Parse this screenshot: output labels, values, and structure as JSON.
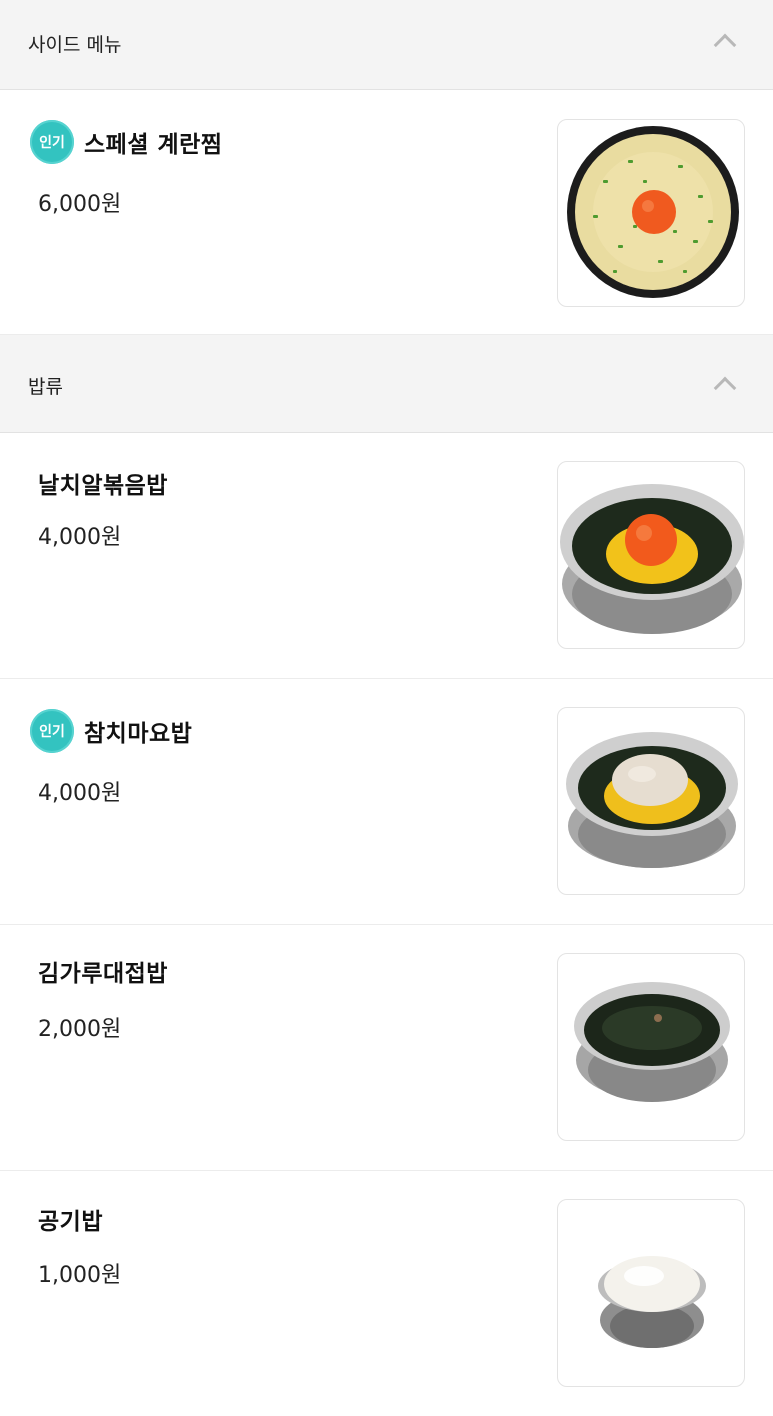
{
  "sections": [
    {
      "title": "사이드 메뉴",
      "items": [
        {
          "name": "스페셜 계란찜",
          "price": "6,000원",
          "badge": "인기",
          "image": "steamed-egg-image"
        }
      ]
    },
    {
      "title": "밥류",
      "items": [
        {
          "name": "날치알볶음밥",
          "price": "4,000원",
          "badge": "",
          "image": "flying-fish-roe-fried-rice-image"
        },
        {
          "name": "참치마요밥",
          "price": "4,000원",
          "badge": "인기",
          "image": "tuna-mayo-rice-image"
        },
        {
          "name": "김가루대접밥",
          "price": "2,000원",
          "badge": "",
          "image": "seaweed-flake-rice-image"
        },
        {
          "name": "공기밥",
          "price": "1,000원",
          "badge": "",
          "image": "bowl-of-rice-image"
        }
      ]
    }
  ],
  "icons": {
    "collapse": "chevron-up-icon"
  },
  "colors": {
    "badge": "#33c3c0",
    "section_bg": "#f4f4f4"
  }
}
